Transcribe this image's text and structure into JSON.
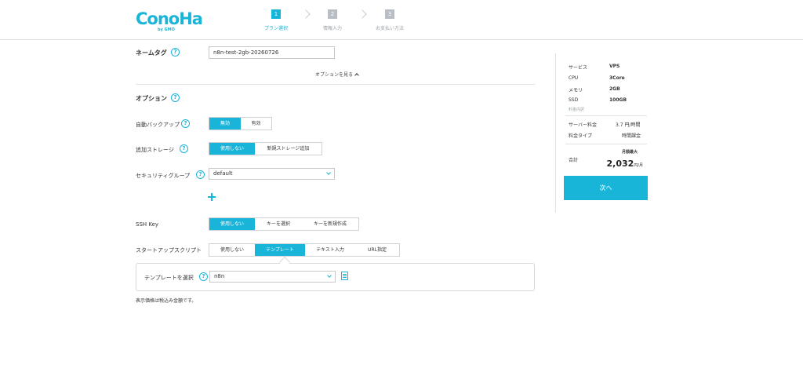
{
  "brand": {
    "logo_text": "ConoHa",
    "logo_sub": "by GMO",
    "color": "#19b5d9"
  },
  "steps": [
    {
      "num": "1",
      "label": "プラン選択",
      "active": true
    },
    {
      "num": "2",
      "label": "情報入力",
      "active": false
    },
    {
      "num": "3",
      "label": "お支払い方法",
      "active": false
    }
  ],
  "form": {
    "nametag": {
      "label": "ネームタグ",
      "value": "n8n-test-2gb-20260726"
    },
    "options_toggle": "オプションを見る",
    "options_heading": "オプション",
    "auto_backup": {
      "label": "自動バックアップ",
      "options": [
        "無効",
        "有効"
      ],
      "selected": "無効"
    },
    "extra_storage": {
      "label": "追加ストレージ",
      "options": [
        "使用しない",
        "新規ストレージ追加"
      ],
      "selected": "使用しない"
    },
    "security_group": {
      "label": "セキュリティグループ",
      "value": "default"
    },
    "ssh_key": {
      "label": "SSH Key",
      "options": [
        "使用しない",
        "キーを選択",
        "キーを新規作成"
      ],
      "selected": "使用しない"
    },
    "startup_script": {
      "label": "スタートアップスクリプト",
      "options": [
        "使用しない",
        "テンプレート",
        "テキスト入力",
        "URL指定"
      ],
      "selected": "テンプレート"
    },
    "template_select": {
      "label": "テンプレートを選択",
      "value": "n8n"
    },
    "help_glyph": "?",
    "tax_note": "表示価格は税込み金額です。"
  },
  "summary": {
    "service": {
      "label": "サービス",
      "value": "VPS"
    },
    "cpu": {
      "label": "CPU",
      "value": "3Core"
    },
    "memory": {
      "label": "メモリ",
      "value": "2GB"
    },
    "ssd": {
      "label": "SSD",
      "value": "100GB"
    },
    "breakdown_label": "料金内訳",
    "server_fee": {
      "label": "サーバー料金",
      "value": "3.7 円/時間"
    },
    "fee_type": {
      "label": "料金タイプ",
      "value": "時間課金"
    },
    "monthly_max": "月額最大",
    "total": {
      "label": "合計",
      "amount": "2,032",
      "unit": "円/月"
    },
    "next_button": "次へ"
  }
}
